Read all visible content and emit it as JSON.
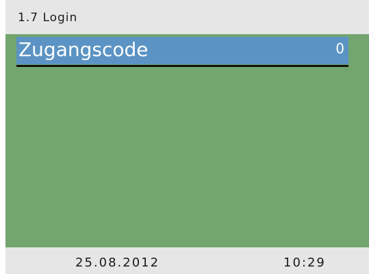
{
  "header": {
    "title": "1.7 Login"
  },
  "menu": {
    "selected_item": {
      "label": "Zugangscode",
      "value": "0"
    }
  },
  "footer": {
    "date": "25.08.2012",
    "time": "10:29"
  },
  "colors": {
    "screen_background": "#73a56f",
    "header_background": "#e6e6e6",
    "selection_highlight": "#5b93c4",
    "selection_underline": "#111111"
  }
}
